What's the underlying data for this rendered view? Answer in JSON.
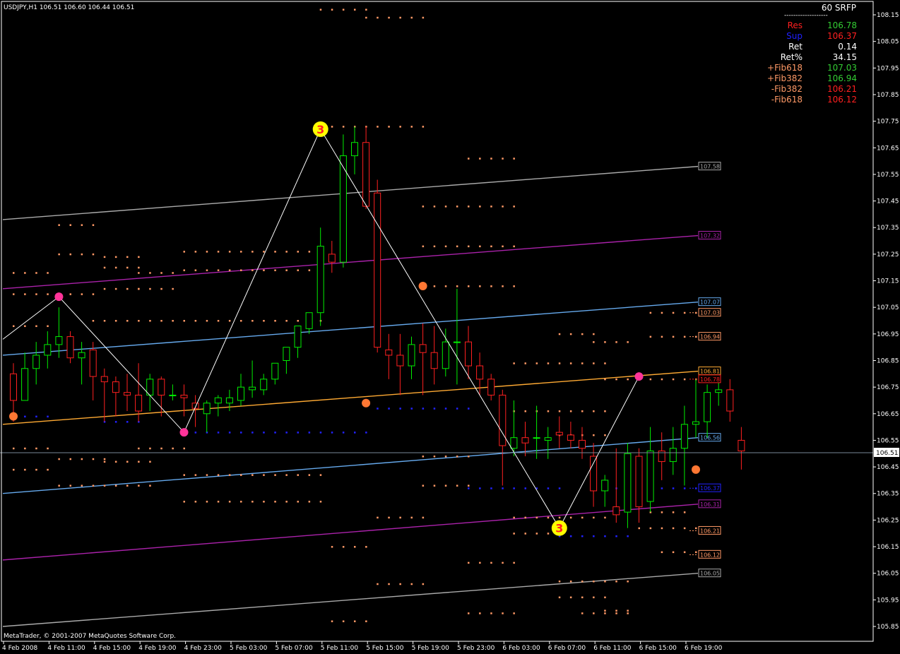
{
  "header": {
    "symbol_line": "USDJPY,H1  106.51 106.60 106.44 106.51",
    "footer": "MetaTrader, © 2001-2007 MetaQuotes Software Corp."
  },
  "info_panel": {
    "title": "60 SRFP",
    "separator": "-------------------",
    "rows": [
      {
        "label": "Res",
        "value": "106.78",
        "label_color": "#ff2020",
        "value_color": "#33cc33"
      },
      {
        "label": "Sup",
        "value": "106.37",
        "label_color": "#2020ff",
        "value_color": "#ff2020"
      },
      {
        "label": "Ret",
        "value": "0.14",
        "label_color": "#ffffff",
        "value_color": "#ffffff"
      },
      {
        "label": "Ret%",
        "value": "34.15",
        "label_color": "#ffffff",
        "value_color": "#ffffff"
      },
      {
        "label": "+Fib618",
        "value": "107.03",
        "label_color": "#ff9966",
        "value_color": "#33cc33"
      },
      {
        "label": "+Fib382",
        "value": "106.94",
        "label_color": "#ff9966",
        "value_color": "#33cc33"
      },
      {
        "label": "-Fib382",
        "value": "106.21",
        "label_color": "#ff9966",
        "value_color": "#ff2020"
      },
      {
        "label": "-Fib618",
        "value": "106.12",
        "label_color": "#ff9966",
        "value_color": "#ff2020"
      }
    ]
  },
  "colors": {
    "background": "#000000",
    "bull": "#00ee00",
    "bear": "#ff2020",
    "axis": "#ffffff",
    "zigzag": "#ffffff",
    "dots": "#ff9966",
    "sup_dots": "#2222ff"
  },
  "chart_data": {
    "type": "candlestick",
    "y_ticks": [
      "108.15",
      "108.05",
      "107.95",
      "107.85",
      "107.75",
      "107.65",
      "107.55",
      "107.45",
      "107.35",
      "107.25",
      "107.15",
      "107.05",
      "106.95",
      "106.85",
      "106.75",
      "106.65",
      "106.55",
      "106.45",
      "106.35",
      "106.25",
      "106.15",
      "106.05",
      "105.95",
      "105.85"
    ],
    "ylim": [
      105.8,
      108.18
    ],
    "current_price": "106.51",
    "x_ticks": [
      "4 Feb 2008",
      "4 Feb 11:00",
      "4 Feb 15:00",
      "4 Feb 19:00",
      "4 Feb 23:00",
      "5 Feb 03:00",
      "5 Feb 07:00",
      "5 Feb 11:00",
      "5 Feb 15:00",
      "5 Feb 19:00",
      "5 Feb 23:00",
      "6 Feb 03:00",
      "6 Feb 07:00",
      "6 Feb 11:00",
      "6 Feb 15:00",
      "6 Feb 19:00"
    ],
    "bars_per_tick": 4,
    "candles": [
      [
        106.8,
        106.84,
        106.62,
        106.7
      ],
      [
        106.7,
        106.88,
        106.7,
        106.82
      ],
      [
        106.82,
        106.92,
        106.76,
        106.87
      ],
      [
        106.87,
        106.96,
        106.82,
        106.91
      ],
      [
        106.91,
        107.05,
        106.86,
        106.94
      ],
      [
        106.94,
        106.96,
        106.84,
        106.86
      ],
      [
        106.86,
        106.92,
        106.76,
        106.88
      ],
      [
        106.89,
        106.92,
        106.7,
        106.79
      ],
      [
        106.79,
        106.82,
        106.62,
        106.77
      ],
      [
        106.77,
        106.79,
        106.64,
        106.73
      ],
      [
        106.73,
        106.8,
        106.66,
        106.72
      ],
      [
        106.72,
        106.84,
        106.62,
        106.66
      ],
      [
        106.72,
        106.8,
        106.66,
        106.78
      ],
      [
        106.78,
        106.79,
        106.64,
        106.72
      ],
      [
        106.72,
        106.76,
        106.7,
        106.72
      ],
      [
        106.72,
        106.76,
        106.64,
        106.71
      ],
      [
        106.69,
        106.72,
        106.6,
        106.67
      ],
      [
        106.65,
        106.7,
        106.58,
        106.69
      ],
      [
        106.69,
        106.72,
        106.64,
        106.71
      ],
      [
        106.69,
        106.74,
        106.66,
        106.71
      ],
      [
        106.7,
        106.8,
        106.68,
        106.75
      ],
      [
        106.74,
        106.85,
        106.71,
        106.75
      ],
      [
        106.74,
        106.8,
        106.72,
        106.78
      ],
      [
        106.78,
        106.84,
        106.76,
        106.84
      ],
      [
        106.85,
        106.9,
        106.8,
        106.9
      ],
      [
        106.9,
        106.96,
        106.86,
        106.98
      ],
      [
        106.97,
        107.03,
        106.95,
        107.03
      ],
      [
        107.03,
        107.35,
        106.98,
        107.28
      ],
      [
        107.25,
        107.3,
        107.18,
        107.22
      ],
      [
        107.22,
        107.7,
        107.2,
        107.62
      ],
      [
        107.62,
        107.73,
        107.55,
        107.67
      ],
      [
        107.67,
        107.73,
        107.42,
        107.43
      ],
      [
        107.48,
        107.53,
        106.88,
        106.9
      ],
      [
        106.89,
        106.95,
        106.78,
        106.87
      ],
      [
        106.87,
        106.95,
        106.72,
        106.83
      ],
      [
        106.83,
        106.94,
        106.78,
        106.91
      ],
      [
        106.91,
        106.99,
        106.72,
        106.88
      ],
      [
        106.88,
        106.98,
        106.76,
        106.82
      ],
      [
        106.82,
        106.97,
        106.79,
        106.92
      ],
      [
        106.92,
        107.12,
        106.76,
        106.92
      ],
      [
        106.92,
        106.98,
        106.78,
        106.83
      ],
      [
        106.83,
        106.88,
        106.72,
        106.78
      ],
      [
        106.78,
        106.8,
        106.7,
        106.72
      ],
      [
        106.72,
        106.74,
        106.38,
        106.53
      ],
      [
        106.52,
        106.7,
        106.49,
        106.56
      ],
      [
        106.56,
        106.62,
        106.49,
        106.54
      ],
      [
        106.56,
        106.68,
        106.48,
        106.56
      ],
      [
        106.55,
        106.6,
        106.48,
        106.56
      ],
      [
        106.58,
        106.64,
        106.52,
        106.57
      ],
      [
        106.57,
        106.62,
        106.52,
        106.55
      ],
      [
        106.55,
        106.6,
        106.48,
        106.52
      ],
      [
        106.49,
        106.54,
        106.3,
        106.36
      ],
      [
        106.36,
        106.42,
        106.3,
        106.4
      ],
      [
        106.3,
        106.52,
        106.24,
        106.27
      ],
      [
        106.28,
        106.54,
        106.22,
        106.5
      ],
      [
        106.49,
        106.52,
        106.24,
        106.3
      ],
      [
        106.32,
        106.6,
        106.28,
        106.51
      ],
      [
        106.51,
        106.58,
        106.4,
        106.47
      ],
      [
        106.47,
        106.6,
        106.42,
        106.52
      ],
      [
        106.52,
        106.68,
        106.38,
        106.61
      ],
      [
        106.61,
        106.78,
        106.56,
        106.62
      ],
      [
        106.62,
        106.76,
        106.56,
        106.73
      ],
      [
        106.73,
        106.78,
        106.68,
        106.74
      ],
      [
        106.74,
        106.78,
        106.62,
        106.66
      ]
    ],
    "last_candle": [
      106.55,
      106.6,
      106.44,
      106.51
    ],
    "channels": [
      {
        "name": "",
        "color": "#aaaaaa",
        "start": 107.38,
        "end": 107.58,
        "label": "107.58"
      },
      {
        "name": "",
        "color": "#aa22aa",
        "start": 107.12,
        "end": 107.32,
        "label": "107.32"
      },
      {
        "name": "",
        "color": "#66aaee",
        "start": 106.87,
        "end": 107.07,
        "label": "107.07"
      },
      {
        "name": "",
        "color": "#ffaa33",
        "start": 106.61,
        "end": 106.81,
        "label": "106.81"
      },
      {
        "name": "",
        "color": "#66aaee",
        "start": 106.35,
        "end": 106.56,
        "label": "106.56"
      },
      {
        "name": "",
        "color": "#aa22aa",
        "start": 106.1,
        "end": 106.31,
        "label": "106.31"
      },
      {
        "name": "",
        "color": "#aaaaaa",
        "start": 105.85,
        "end": 106.05,
        "label": "106.05"
      }
    ],
    "right_tags": [
      {
        "value": "107.03",
        "color": "#ff9966"
      },
      {
        "value": "106.94",
        "color": "#ff9966"
      },
      {
        "value": "106.78",
        "color": "#ff2020"
      },
      {
        "value": "106.37",
        "color": "#2222ff"
      },
      {
        "value": "106.21",
        "color": "#ff9966"
      },
      {
        "value": "106.12",
        "color": "#ff9966"
      }
    ],
    "zigzag": [
      [
        -1,
        106.93
      ],
      [
        4,
        107.09
      ],
      [
        15,
        106.58
      ],
      [
        27,
        107.72
      ],
      [
        57,
        106.22
      ],
      [
        55,
        106.22
      ],
      [
        58,
        106.22
      ],
      [
        55,
        106.79
      ]
    ],
    "pivots": [
      {
        "bar": 27,
        "price": 107.72,
        "label": "3",
        "color": "#ffff00",
        "big": true
      },
      {
        "bar": 48,
        "price": 106.22,
        "label": "3",
        "color": "#ffff00",
        "big": true
      },
      {
        "bar": 4,
        "price": 107.09,
        "label": "",
        "color": "#ff3399",
        "big": false
      },
      {
        "bar": 15,
        "price": 106.58,
        "label": "",
        "color": "#ff3399",
        "big": false
      },
      {
        "bar": 55,
        "price": 106.79,
        "label": "",
        "color": "#ff3399",
        "big": false
      },
      {
        "bar": 0,
        "price": 106.64,
        "label": "",
        "color": "#ff7733",
        "big": false
      },
      {
        "bar": 31,
        "price": 106.69,
        "label": "",
        "color": "#ff7733",
        "big": false
      },
      {
        "bar": 36,
        "price": 107.13,
        "label": "",
        "color": "#ff7733",
        "big": false
      },
      {
        "bar": 60,
        "price": 106.44,
        "label": "",
        "color": "#ff7733",
        "big": false
      }
    ],
    "dot_rows": [
      {
        "from": 27,
        "to": 31,
        "price": 108.17
      },
      {
        "from": 31,
        "to": 36,
        "price": 108.14
      },
      {
        "from": 27,
        "to": 36,
        "price": 107.73
      },
      {
        "from": 40,
        "to": 44,
        "price": 107.61
      },
      {
        "from": 36,
        "to": 44,
        "price": 107.43
      },
      {
        "from": 36,
        "to": 44,
        "price": 107.28
      },
      {
        "from": 4,
        "to": 7,
        "price": 107.36
      },
      {
        "from": 4,
        "to": 7,
        "price": 107.25
      },
      {
        "from": 8,
        "to": 11,
        "price": 107.24
      },
      {
        "from": 15,
        "to": 27,
        "price": 107.26
      },
      {
        "from": 0,
        "to": 3,
        "price": 107.18
      },
      {
        "from": 8,
        "to": 11,
        "price": 107.2
      },
      {
        "from": 11,
        "to": 14,
        "price": 107.18
      },
      {
        "from": 15,
        "to": 27,
        "price": 107.19
      },
      {
        "from": 8,
        "to": 11,
        "price": 107.12
      },
      {
        "from": 11,
        "to": 14,
        "price": 107.12
      },
      {
        "from": 0,
        "to": 7,
        "price": 107.1
      },
      {
        "from": 36,
        "to": 44,
        "price": 107.13
      },
      {
        "from": 7,
        "to": 27,
        "price": 107.0
      },
      {
        "from": 0,
        "to": 3,
        "price": 106.98
      },
      {
        "from": 56,
        "to": 60,
        "price": 107.03
      },
      {
        "from": 48,
        "to": 51,
        "price": 106.95
      },
      {
        "from": 51,
        "to": 54,
        "price": 106.92
      },
      {
        "from": 56,
        "to": 60,
        "price": 106.94
      },
      {
        "from": 44,
        "to": 52,
        "price": 106.84
      },
      {
        "from": 52,
        "to": 60,
        "price": 106.78
      },
      {
        "from": 32,
        "to": 40,
        "price": 106.67
      },
      {
        "from": 44,
        "to": 52,
        "price": 106.66
      },
      {
        "from": 0,
        "to": 3,
        "price": 106.64
      },
      {
        "from": 8,
        "to": 11,
        "price": 106.62
      },
      {
        "from": 15,
        "to": 31,
        "price": 106.58
      },
      {
        "from": 48,
        "to": 52,
        "price": 106.57
      },
      {
        "from": 0,
        "to": 3,
        "price": 106.52
      },
      {
        "from": 11,
        "to": 15,
        "price": 106.52
      },
      {
        "from": 36,
        "to": 40,
        "price": 106.49
      },
      {
        "from": 4,
        "to": 8,
        "price": 106.48
      },
      {
        "from": 8,
        "to": 12,
        "price": 106.47
      },
      {
        "from": 0,
        "to": 3,
        "price": 106.44
      },
      {
        "from": 15,
        "to": 27,
        "price": 106.42
      },
      {
        "from": 4,
        "to": 12,
        "price": 106.38
      },
      {
        "from": 40,
        "to": 48,
        "price": 106.37
      },
      {
        "from": 52,
        "to": 60,
        "price": 106.37
      },
      {
        "from": 36,
        "to": 40,
        "price": 106.38
      },
      {
        "from": 15,
        "to": 27,
        "price": 106.32
      },
      {
        "from": 56,
        "to": 59,
        "price": 106.28
      },
      {
        "from": 32,
        "to": 36,
        "price": 106.26
      },
      {
        "from": 44,
        "to": 52,
        "price": 106.26
      },
      {
        "from": 55,
        "to": 60,
        "price": 106.22
      },
      {
        "from": 48,
        "to": 54,
        "price": 106.19
      },
      {
        "from": 44,
        "to": 48,
        "price": 106.2
      },
      {
        "from": 28,
        "to": 31,
        "price": 106.15
      },
      {
        "from": 57,
        "to": 60,
        "price": 106.13
      },
      {
        "from": 40,
        "to": 44,
        "price": 106.09
      },
      {
        "from": 32,
        "to": 36,
        "price": 106.01
      },
      {
        "from": 48,
        "to": 54,
        "price": 106.02
      },
      {
        "from": 48,
        "to": 52,
        "price": 105.96
      },
      {
        "from": 52,
        "to": 54,
        "price": 105.91
      },
      {
        "from": 40,
        "to": 44,
        "price": 105.9
      },
      {
        "from": 50,
        "to": 54,
        "price": 105.9
      },
      {
        "from": 28,
        "to": 31,
        "price": 105.87
      }
    ]
  }
}
